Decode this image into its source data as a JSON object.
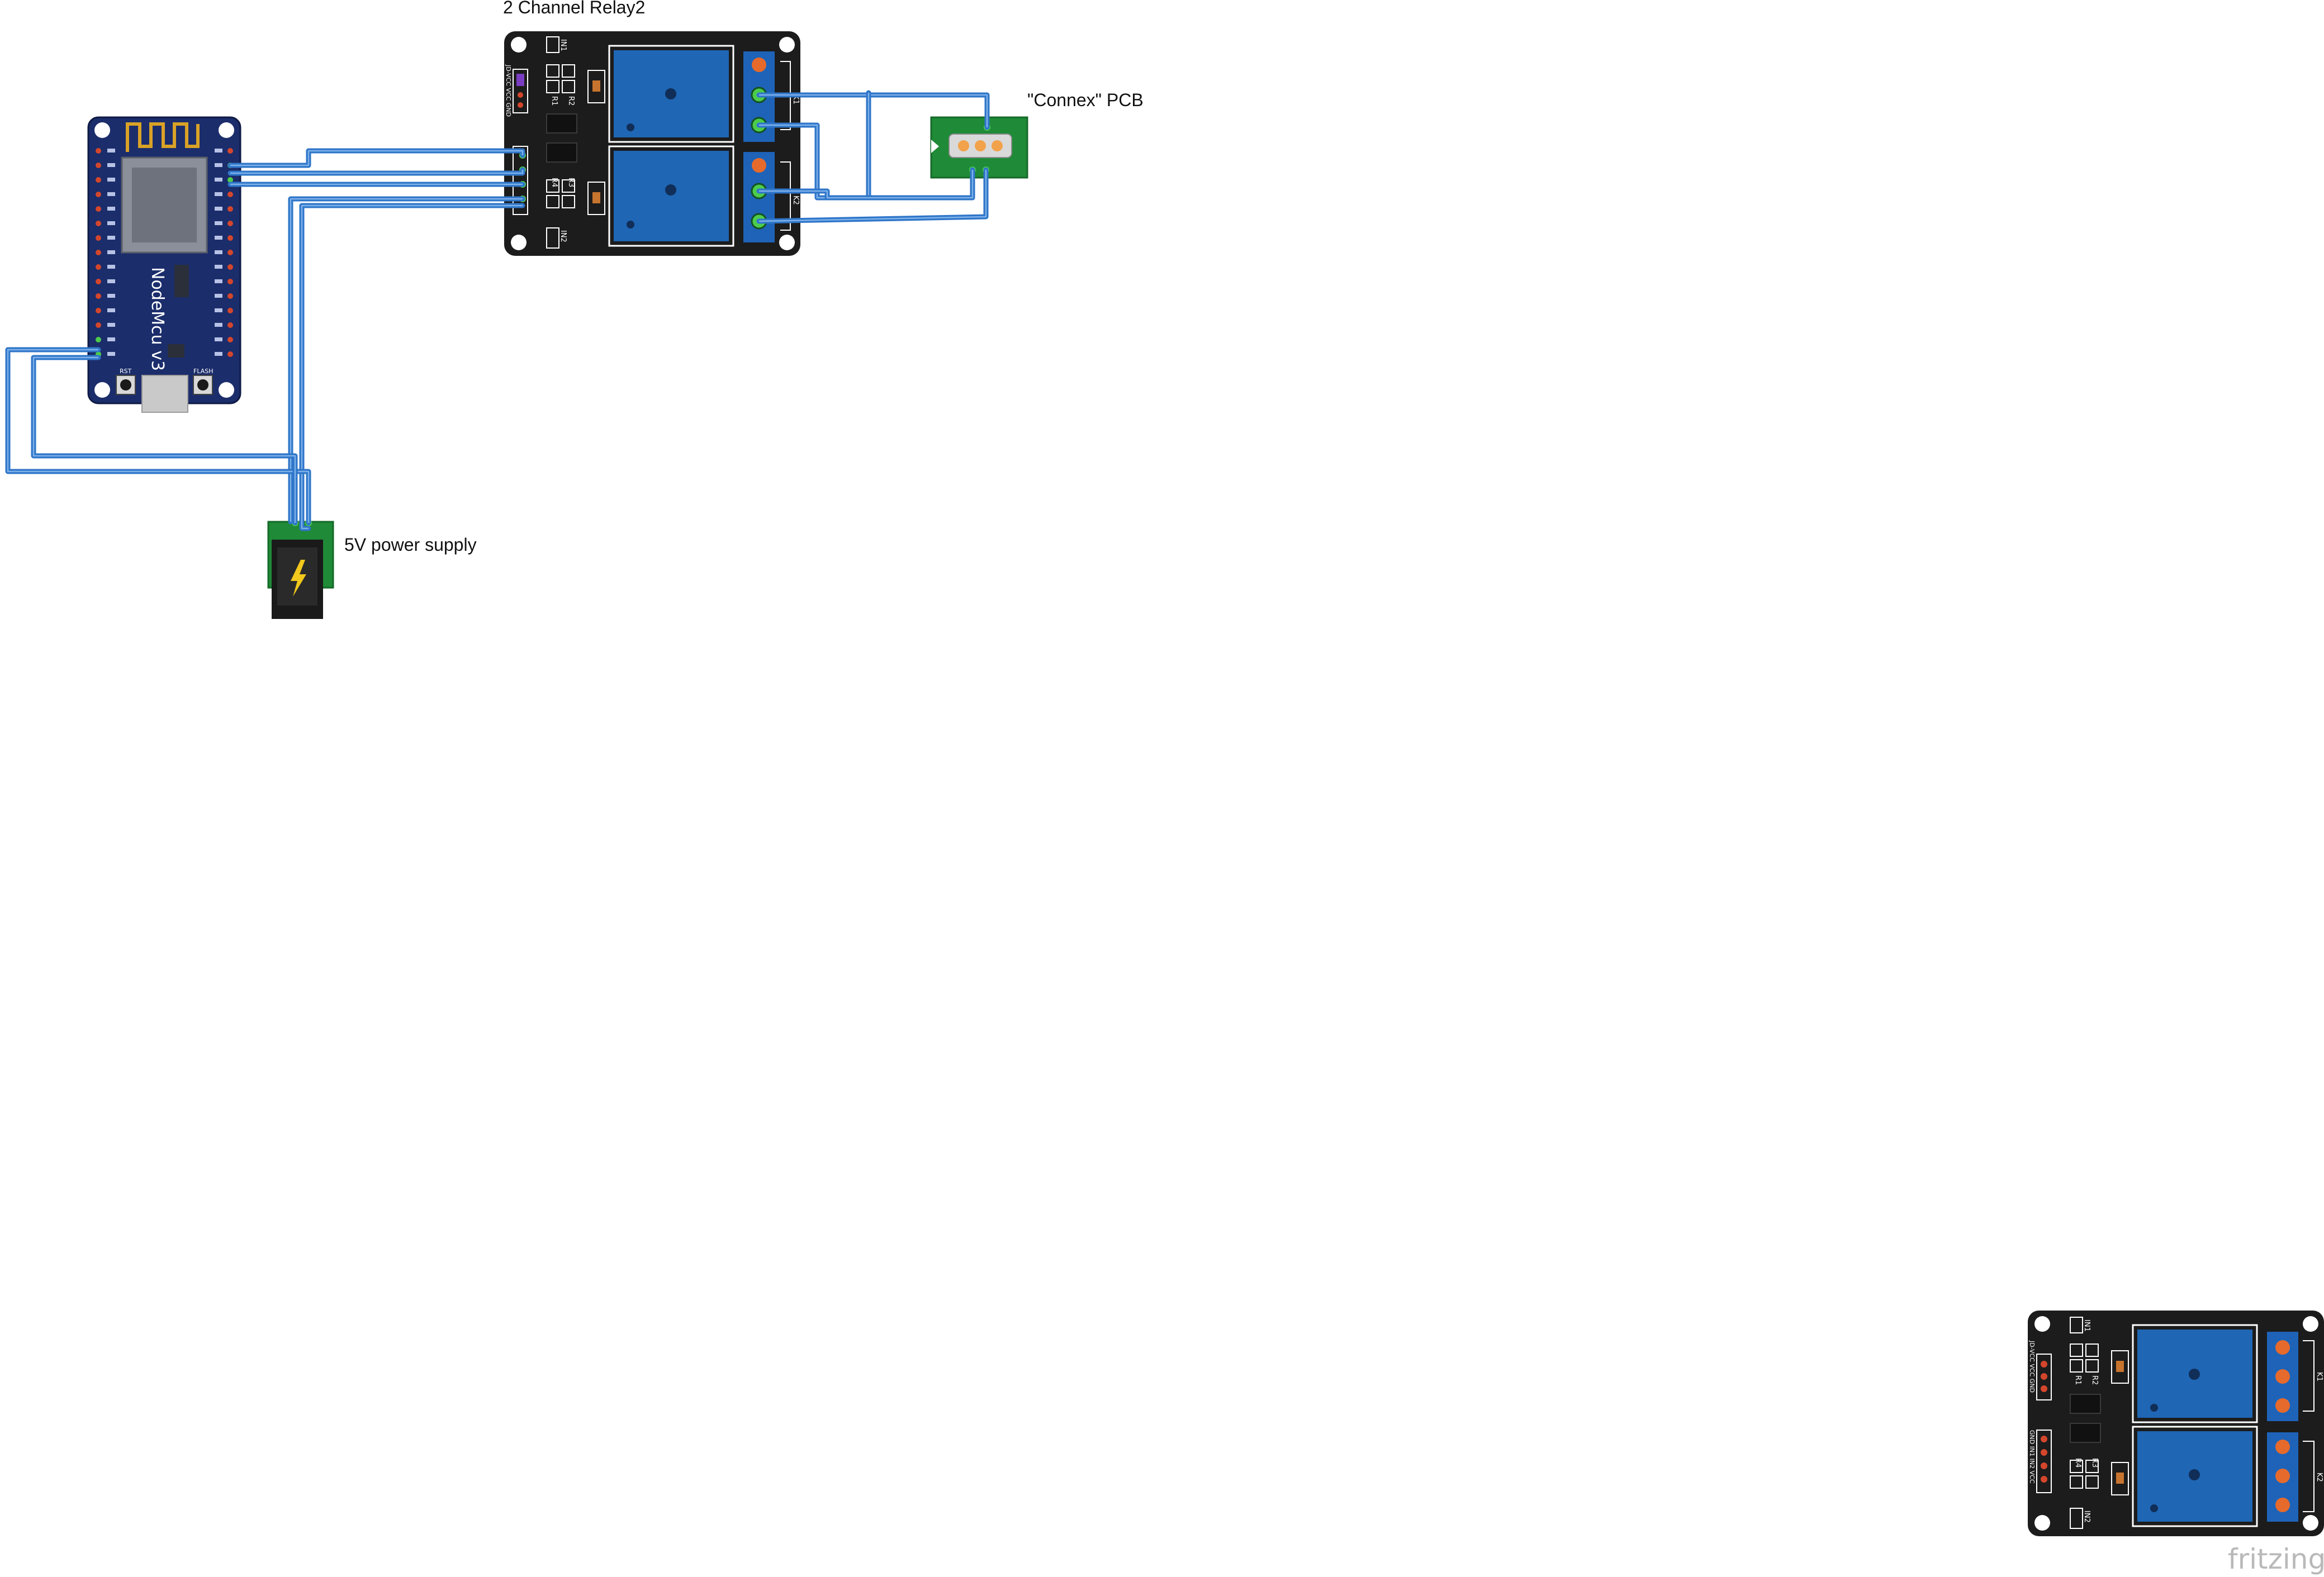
{
  "labels": {
    "relay_top": "2 Channel Relay2",
    "connex": "\"Connex\" PCB",
    "power": "5V power supply",
    "nodemcu": "NodeMcu v3",
    "nodemcu_rst": "RST",
    "nodemcu_flash": "FLASH",
    "relay_r1": "R1",
    "relay_r2": "R2",
    "relay_r3": "R3",
    "relay_r4": "R4",
    "relay_in1": "IN1",
    "relay_in2": "IN2",
    "relay_jd": "JD-VCC VCC GND",
    "relay_gnd_pins": "GND IN1 IN2 VCC",
    "relay_k1": "K1",
    "relay_k2": "K2",
    "brand": "fritzing"
  },
  "colors": {
    "wire": "#2f76c9",
    "relay_board": "#1c1c1c",
    "relay_coil": "#1f66b5",
    "terminal": "#1e63b8",
    "terminal_screw": "#e66a2c",
    "nodemcu_board": "#1b2d6b",
    "connex_board": "#1f8a37",
    "power_board": "#1f8a37",
    "pin_green": "#4ccc4c"
  }
}
